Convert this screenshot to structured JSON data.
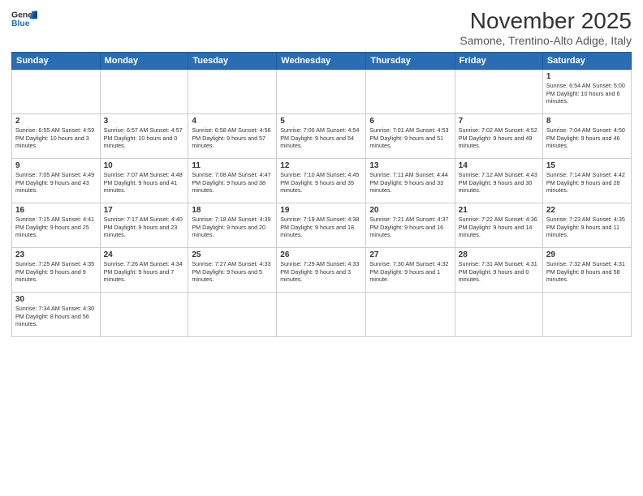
{
  "header": {
    "logo_line1": "General",
    "logo_line2": "Blue",
    "month": "November 2025",
    "location": "Samone, Trentino-Alto Adige, Italy"
  },
  "weekdays": [
    "Sunday",
    "Monday",
    "Tuesday",
    "Wednesday",
    "Thursday",
    "Friday",
    "Saturday"
  ],
  "weeks": [
    [
      {
        "day": "",
        "info": ""
      },
      {
        "day": "",
        "info": ""
      },
      {
        "day": "",
        "info": ""
      },
      {
        "day": "",
        "info": ""
      },
      {
        "day": "",
        "info": ""
      },
      {
        "day": "",
        "info": ""
      },
      {
        "day": "1",
        "info": "Sunrise: 6:54 AM\nSunset: 5:00 PM\nDaylight: 10 hours\nand 6 minutes."
      }
    ],
    [
      {
        "day": "2",
        "info": "Sunrise: 6:55 AM\nSunset: 4:59 PM\nDaylight: 10 hours\nand 3 minutes."
      },
      {
        "day": "3",
        "info": "Sunrise: 6:57 AM\nSunset: 4:57 PM\nDaylight: 10 hours\nand 0 minutes."
      },
      {
        "day": "4",
        "info": "Sunrise: 6:58 AM\nSunset: 4:56 PM\nDaylight: 9 hours\nand 57 minutes."
      },
      {
        "day": "5",
        "info": "Sunrise: 7:00 AM\nSunset: 4:54 PM\nDaylight: 9 hours\nand 54 minutes."
      },
      {
        "day": "6",
        "info": "Sunrise: 7:01 AM\nSunset: 4:53 PM\nDaylight: 9 hours\nand 51 minutes."
      },
      {
        "day": "7",
        "info": "Sunrise: 7:02 AM\nSunset: 4:52 PM\nDaylight: 9 hours\nand 49 minutes."
      },
      {
        "day": "8",
        "info": "Sunrise: 7:04 AM\nSunset: 4:50 PM\nDaylight: 9 hours\nand 46 minutes."
      }
    ],
    [
      {
        "day": "9",
        "info": "Sunrise: 7:05 AM\nSunset: 4:49 PM\nDaylight: 9 hours\nand 43 minutes."
      },
      {
        "day": "10",
        "info": "Sunrise: 7:07 AM\nSunset: 4:48 PM\nDaylight: 9 hours\nand 41 minutes."
      },
      {
        "day": "11",
        "info": "Sunrise: 7:08 AM\nSunset: 4:47 PM\nDaylight: 9 hours\nand 38 minutes."
      },
      {
        "day": "12",
        "info": "Sunrise: 7:10 AM\nSunset: 4:45 PM\nDaylight: 9 hours\nand 35 minutes."
      },
      {
        "day": "13",
        "info": "Sunrise: 7:11 AM\nSunset: 4:44 PM\nDaylight: 9 hours\nand 33 minutes."
      },
      {
        "day": "14",
        "info": "Sunrise: 7:12 AM\nSunset: 4:43 PM\nDaylight: 9 hours\nand 30 minutes."
      },
      {
        "day": "15",
        "info": "Sunrise: 7:14 AM\nSunset: 4:42 PM\nDaylight: 9 hours\nand 28 minutes."
      }
    ],
    [
      {
        "day": "16",
        "info": "Sunrise: 7:15 AM\nSunset: 4:41 PM\nDaylight: 9 hours\nand 25 minutes."
      },
      {
        "day": "17",
        "info": "Sunrise: 7:17 AM\nSunset: 4:40 PM\nDaylight: 9 hours\nand 23 minutes."
      },
      {
        "day": "18",
        "info": "Sunrise: 7:18 AM\nSunset: 4:39 PM\nDaylight: 9 hours\nand 20 minutes."
      },
      {
        "day": "19",
        "info": "Sunrise: 7:19 AM\nSunset: 4:38 PM\nDaylight: 9 hours\nand 18 minutes."
      },
      {
        "day": "20",
        "info": "Sunrise: 7:21 AM\nSunset: 4:37 PM\nDaylight: 9 hours\nand 16 minutes."
      },
      {
        "day": "21",
        "info": "Sunrise: 7:22 AM\nSunset: 4:36 PM\nDaylight: 9 hours\nand 14 minutes."
      },
      {
        "day": "22",
        "info": "Sunrise: 7:23 AM\nSunset: 4:35 PM\nDaylight: 9 hours\nand 11 minutes."
      }
    ],
    [
      {
        "day": "23",
        "info": "Sunrise: 7:25 AM\nSunset: 4:35 PM\nDaylight: 9 hours\nand 9 minutes."
      },
      {
        "day": "24",
        "info": "Sunrise: 7:26 AM\nSunset: 4:34 PM\nDaylight: 9 hours\nand 7 minutes."
      },
      {
        "day": "25",
        "info": "Sunrise: 7:27 AM\nSunset: 4:33 PM\nDaylight: 9 hours\nand 5 minutes."
      },
      {
        "day": "26",
        "info": "Sunrise: 7:29 AM\nSunset: 4:33 PM\nDaylight: 9 hours\nand 3 minutes."
      },
      {
        "day": "27",
        "info": "Sunrise: 7:30 AM\nSunset: 4:32 PM\nDaylight: 9 hours\nand 1 minute."
      },
      {
        "day": "28",
        "info": "Sunrise: 7:31 AM\nSunset: 4:31 PM\nDaylight: 9 hours\nand 0 minutes."
      },
      {
        "day": "29",
        "info": "Sunrise: 7:32 AM\nSunset: 4:31 PM\nDaylight: 8 hours\nand 58 minutes."
      }
    ],
    [
      {
        "day": "30",
        "info": "Sunrise: 7:34 AM\nSunset: 4:30 PM\nDaylight: 8 hours\nand 56 minutes."
      },
      {
        "day": "",
        "info": ""
      },
      {
        "day": "",
        "info": ""
      },
      {
        "day": "",
        "info": ""
      },
      {
        "day": "",
        "info": ""
      },
      {
        "day": "",
        "info": ""
      },
      {
        "day": "",
        "info": ""
      }
    ]
  ]
}
